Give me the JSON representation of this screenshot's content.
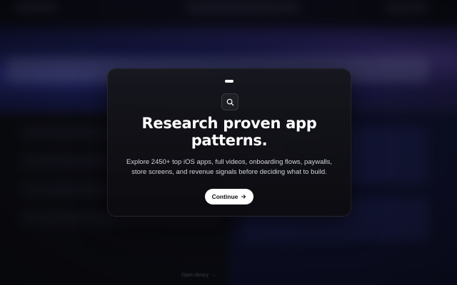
{
  "modal": {
    "icon": "search-icon",
    "title": "Research proven app patterns.",
    "description": "Explore 2450+ top iOS apps, full videos, onboarding flows, paywalls, store screens, and revenue signals before deciding what to build.",
    "continue_label": "Continue",
    "continue_icon": "arrow-right-icon"
  },
  "background": {
    "footer_text": "Open library",
    "footer_arrow": "→"
  },
  "colors": {
    "modal_bg": "#121218",
    "button_bg": "#ffffff",
    "button_text": "#111111",
    "accent_blue": "#3a3fa8",
    "accent_purple": "#5b4aa8"
  }
}
